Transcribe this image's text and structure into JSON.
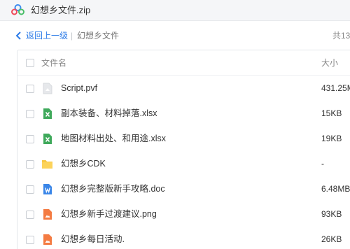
{
  "window": {
    "title": "幻想乡文件.zip",
    "logo_icon": "cloud-drive-logo-icon"
  },
  "nav": {
    "back_label": "返回上一级",
    "separator": "|",
    "current_folder": "幻想乡文件",
    "total_label": "共13"
  },
  "table": {
    "columns": {
      "name": "文件名",
      "size": "大小"
    },
    "rows": [
      {
        "name": "Script.pvf",
        "size": "431.25M",
        "icon": "generic-file-icon"
      },
      {
        "name": "副本装备、材料掉落.xlsx",
        "size": "15KB",
        "icon": "excel-file-icon"
      },
      {
        "name": "地图材料出处、和用途.xlsx",
        "size": "19KB",
        "icon": "excel-file-icon"
      },
      {
        "name": "幻想乡CDK",
        "size": "-",
        "icon": "folder-icon"
      },
      {
        "name": "幻想乡完整版新手攻略.doc",
        "size": "6.48MB",
        "icon": "word-file-icon"
      },
      {
        "name": "幻想乡新手过渡建议.png",
        "size": "93KB",
        "icon": "image-file-icon"
      },
      {
        "name": "幻想乡每日活动.",
        "size": "26KB",
        "icon": "image-file-icon"
      }
    ]
  },
  "colors": {
    "accent": "#2d7ce8",
    "excel": "#3fa95b",
    "word": "#3a86e8",
    "image": "#f47b42",
    "folder": "#f8c845"
  }
}
